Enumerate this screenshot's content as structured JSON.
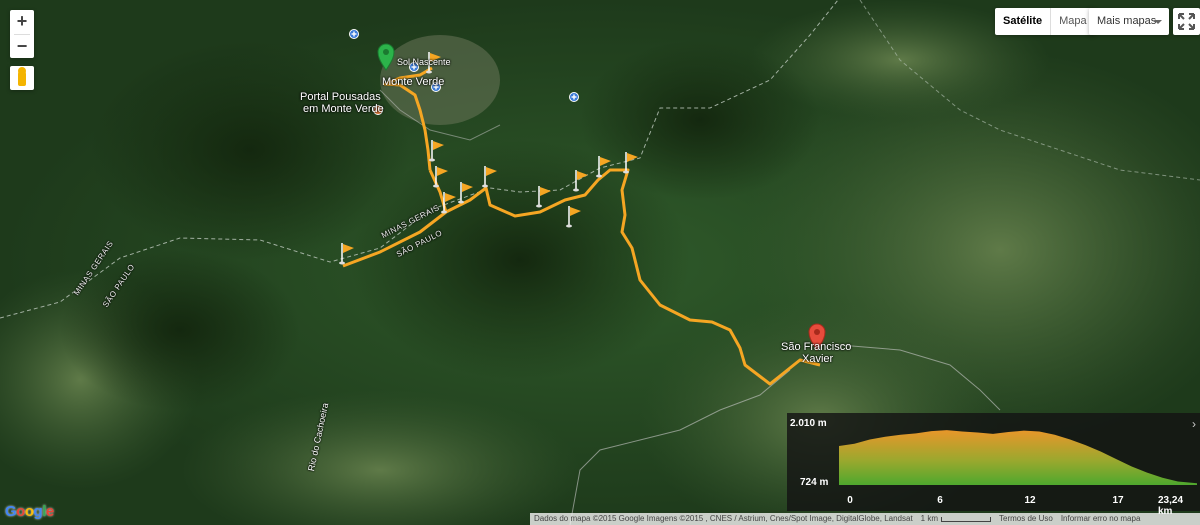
{
  "controls": {
    "zoom_in": "+",
    "zoom_out": "−",
    "map_types": [
      "Satélite",
      "Mapa"
    ],
    "more_maps": "Mais mapas",
    "icons": [
      "plus-icon",
      "minus-icon",
      "pegman-icon",
      "caret-down-icon",
      "fullscreen-icon"
    ]
  },
  "places": {
    "start_label": "Monte Verde",
    "street_label": "Sol Nascente",
    "poi_label_line1": "Portal Pousadas",
    "poi_label_line2": "em Monte Verde",
    "end_label_line1": "São Francisco",
    "end_label_line2": "Xavier",
    "river_label": "Rio do Cachoeira"
  },
  "state_labels": {
    "a_top": "MINAS GERAIS",
    "a_bottom": "SÃO PAULO",
    "b_top": "MINAS GERAIS",
    "b_bottom": "SÃO PAULO"
  },
  "colors": {
    "route": "#f5a623",
    "start_marker": "#2cb34a",
    "end_marker": "#e74c3c",
    "border_line": "#b8c4b8"
  },
  "elevation": {
    "max_label": "2.010 m",
    "min_label": "724 m",
    "x_ticks": [
      "0",
      "6",
      "12",
      "17",
      "23,24 km"
    ],
    "max_m": 2010,
    "min_m": 724,
    "total_km": 23.24,
    "profile_km": [
      0,
      1,
      2,
      3,
      4,
      5,
      6,
      7,
      8,
      9,
      10,
      11,
      12,
      13,
      14,
      15,
      16,
      17,
      18,
      19,
      20,
      21,
      22,
      23.24
    ],
    "profile_m": [
      1560,
      1610,
      1700,
      1760,
      1800,
      1830,
      1880,
      1900,
      1870,
      1850,
      1820,
      1860,
      1890,
      1870,
      1800,
      1700,
      1580,
      1440,
      1280,
      1120,
      990,
      880,
      800,
      760
    ]
  },
  "footer": {
    "logo": [
      "G",
      "o",
      "o",
      "g",
      "l",
      "e"
    ],
    "logo_colors": [
      "#4285f4",
      "#ea4335",
      "#fbbc05",
      "#4285f4",
      "#34a853",
      "#ea4335"
    ],
    "attribution": "Dados do mapa ©2015 Google Imagens ©2015 , CNES / Astrium, Cnes/Spot Image, DigitalGlobe, Landsat",
    "scale": "1 km",
    "terms": "Termos de Uso",
    "report": "Informar erro no mapa"
  }
}
